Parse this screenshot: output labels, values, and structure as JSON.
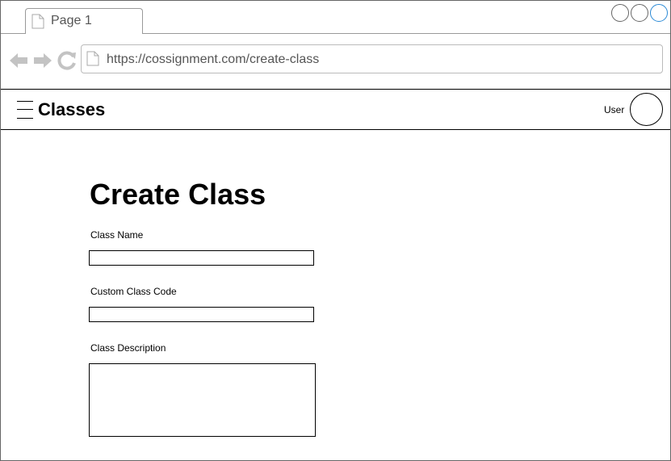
{
  "browser": {
    "tab_title": "Page 1",
    "url": "https://cossignment.com/create-class",
    "accent_color": "#2b8ad6"
  },
  "header": {
    "app_title": "Classes",
    "user_label": "User"
  },
  "form": {
    "title": "Create Class",
    "class_name_label": "Class Name",
    "class_name_value": "",
    "class_code_label": "Custom Class Code",
    "class_code_value": "",
    "description_label": "Class Description",
    "description_value": ""
  },
  "icons": [
    "page-icon",
    "back-arrow-icon",
    "forward-arrow-icon",
    "reload-icon",
    "hamburger-menu-icon",
    "user-avatar-icon"
  ]
}
